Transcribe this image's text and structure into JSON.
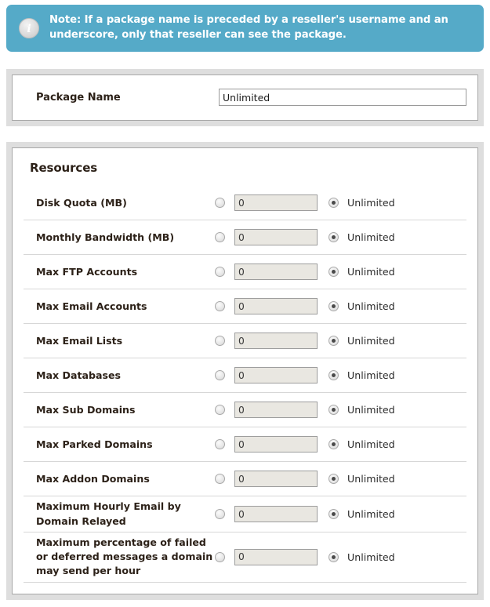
{
  "note": {
    "icon": "info-icon",
    "text": "Note: If a package name is preceded by a reseller's username and an underscore, only that reseller can see the package."
  },
  "package": {
    "label": "Package Name",
    "value": "Unlimited",
    "placeholder": ""
  },
  "resources": {
    "title": "Resources",
    "unlimited_label": "Unlimited",
    "value_placeholder": "",
    "rows": [
      {
        "label": "Disk Quota (MB)",
        "value": "0",
        "unlimited_label": "Unlimited",
        "selected": "unlimited"
      },
      {
        "label": "Monthly Bandwidth (MB)",
        "value": "0",
        "unlimited_label": "Unlimited",
        "selected": "unlimited"
      },
      {
        "label": "Max FTP Accounts",
        "value": "0",
        "unlimited_label": "Unlimited",
        "selected": "unlimited"
      },
      {
        "label": "Max Email Accounts",
        "value": "0",
        "unlimited_label": "Unlimited",
        "selected": "unlimited"
      },
      {
        "label": "Max Email Lists",
        "value": "0",
        "unlimited_label": "Unlimited",
        "selected": "unlimited"
      },
      {
        "label": "Max Databases",
        "value": "0",
        "unlimited_label": "Unlimited",
        "selected": "unlimited"
      },
      {
        "label": "Max Sub Domains",
        "value": "0",
        "unlimited_label": "Unlimited",
        "selected": "unlimited"
      },
      {
        "label": "Max Parked Domains",
        "value": "0",
        "unlimited_label": "Unlimited",
        "selected": "unlimited"
      },
      {
        "label": "Max Addon Domains",
        "value": "0",
        "unlimited_label": "Unlimited",
        "selected": "unlimited"
      },
      {
        "label": "Maximum Hourly Email by Domain Relayed",
        "value": "0",
        "unlimited_label": "Unlimited",
        "selected": "unlimited"
      },
      {
        "label": "Maximum percentage of failed or deferred messages a domain may send per hour",
        "value": "0",
        "unlimited_label": "Unlimited",
        "selected": "unlimited"
      }
    ]
  },
  "colors": {
    "note_background": "#55aac8",
    "panel_background": "#dedede",
    "panel_border": "#a8a8a8",
    "label_text": "#2c2118",
    "disabled_field": "#e9e7e1",
    "divider": "#d7d7d7"
  }
}
